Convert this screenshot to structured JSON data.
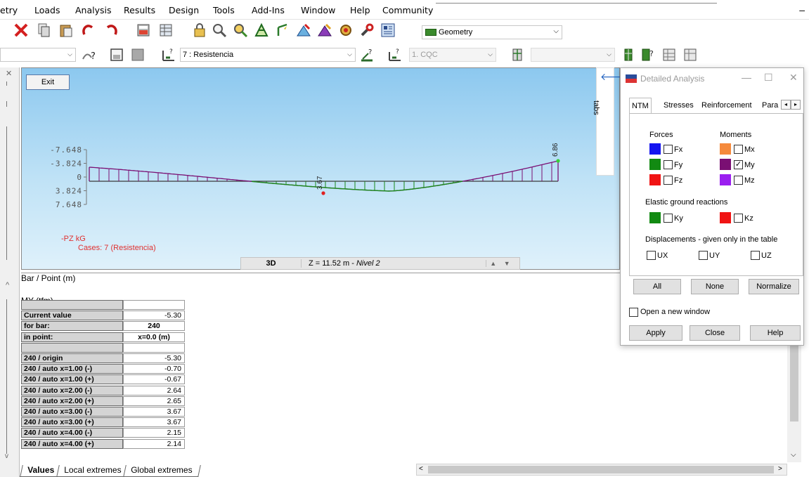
{
  "menu": [
    "etry",
    "Loads",
    "Analysis",
    "Results",
    "Design",
    "Tools",
    "Add-Ins",
    "Window",
    "Help",
    "Community"
  ],
  "minimize_glyph": "–",
  "toolbar1": {
    "geometry_select": "Geometry"
  },
  "toolbar2": {
    "case_select": "7 : Resistencia",
    "combo_select": "1. CQC"
  },
  "viewport": {
    "exit_label": "Exit",
    "scale_labels": [
      "-7.648",
      "-3.824",
      "0",
      "3.824",
      "7.648"
    ],
    "value_labels": [
      "3.67",
      "6.86"
    ],
    "legend_quantity": "-PZ kG",
    "legend_cases": "Cases: 7 (Resistencia)",
    "tabs_label": "tabs",
    "view_mode": "3D",
    "level_prefix": "Z = 11.52 m - ",
    "level_name": "Nivel 2",
    "colors": {
      "positive": "#7a0f73",
      "negative": "#1a8a1a",
      "start_node": "#e02020",
      "end_node": "#38d038"
    }
  },
  "table": {
    "headers": [
      "Bar / Point (m)",
      "MY (tfm)"
    ],
    "rows": [
      {
        "label": "",
        "value": ""
      },
      {
        "label": "Current value",
        "value": "-5.30"
      },
      {
        "label": "for bar:",
        "value": "240"
      },
      {
        "label": "in point:",
        "value": "x=0.0 (m)"
      },
      {
        "label": "",
        "value": ""
      },
      {
        "label": "240 / origin",
        "value": "-5.30"
      },
      {
        "label": "240 / auto x=1.00 (-)",
        "value": "-0.70"
      },
      {
        "label": "240 / auto x=1.00 (+)",
        "value": "-0.67"
      },
      {
        "label": "240 / auto x=2.00 (-)",
        "value": "2.64"
      },
      {
        "label": "240 / auto x=2.00 (+)",
        "value": "2.65"
      },
      {
        "label": "240 / auto x=3.00 (-)",
        "value": "3.67"
      },
      {
        "label": "240 / auto x=3.00 (+)",
        "value": "3.67"
      },
      {
        "label": "240 / auto x=4.00 (-)",
        "value": "2.15"
      },
      {
        "label": "240 / auto x=4.00 (+)",
        "value": "2.14"
      }
    ],
    "sheet_tabs": [
      "Values",
      "Local extremes",
      "Global extremes"
    ]
  },
  "dialog": {
    "title": "Detailed Analysis",
    "tabs": [
      "NTM",
      "Stresses",
      "Reinforcement",
      "Para"
    ],
    "forces_label": "Forces",
    "moments_label": "Moments",
    "items": [
      {
        "label": "Fx",
        "color": "#1414f0",
        "checked": false
      },
      {
        "label": "Fy",
        "color": "#128a12",
        "checked": false
      },
      {
        "label": "Fz",
        "color": "#f01414",
        "checked": false
      },
      {
        "label": "Mx",
        "color": "#f58a3c",
        "checked": false
      },
      {
        "label": "My",
        "color": "#7a0f73",
        "checked": true
      },
      {
        "label": "Mz",
        "color": "#9b1ff0",
        "checked": false
      }
    ],
    "elastic_label": "Elastic ground reactions",
    "elastic_items": [
      {
        "label": "Ky",
        "color": "#128a12",
        "checked": false
      },
      {
        "label": "Kz",
        "color": "#f01414",
        "checked": false
      }
    ],
    "displacements_label": "Displacements - given only in the table",
    "disp_items": [
      "UX",
      "UY",
      "UZ"
    ],
    "btn_all": "All",
    "btn_none": "None",
    "btn_normalize": "Normalize",
    "open_new_window": "Open a new window",
    "btn_apply": "Apply",
    "btn_close": "Close",
    "btn_help": "Help",
    "check_glyph": "✓"
  }
}
